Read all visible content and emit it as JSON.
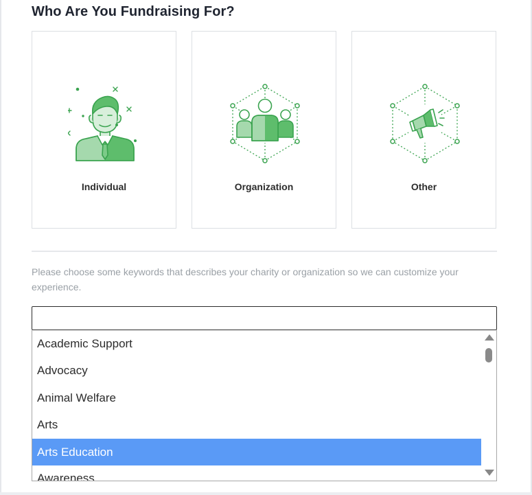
{
  "heading": "Who Are You Fundraising For?",
  "cards": [
    {
      "label": "Individual",
      "icon": "person-icon"
    },
    {
      "label": "Organization",
      "icon": "group-network-icon"
    },
    {
      "label": "Other",
      "icon": "megaphone-network-icon"
    }
  ],
  "helper_text": "Please choose some keywords that describes your charity or organization so we can customize your experience.",
  "keyword_input": {
    "value": "",
    "placeholder": ""
  },
  "keywords": {
    "items": [
      "Academic Support",
      "Advocacy",
      "Animal Welfare",
      "Arts",
      "Arts Education",
      "Awareness"
    ],
    "selected": "Arts Education"
  },
  "colors": {
    "icon_green": "#3aa34f",
    "icon_fill": "#a5d9ad",
    "selected_bg": "#5a9af6",
    "helper_text": "#9aa0a6"
  }
}
